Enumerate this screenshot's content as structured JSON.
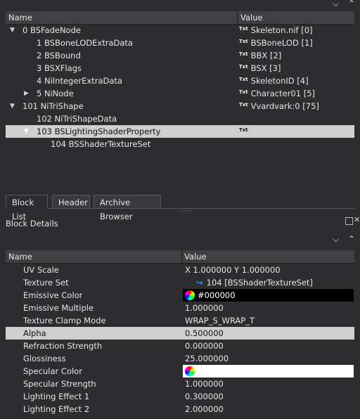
{
  "top_tree": {
    "columns": [
      "Name",
      "Value"
    ],
    "rows": [
      {
        "name": "0 BSFadeNode",
        "value": "Skeleton.nif [0]",
        "indent": 0,
        "expander": "down",
        "badge": "Txt"
      },
      {
        "name": "1 BSBoneLODExtraData",
        "value": "BSBoneLOD [1]",
        "indent": 1,
        "expander": "",
        "badge": "Txt"
      },
      {
        "name": "2 BSBound",
        "value": "BBX [2]",
        "indent": 1,
        "expander": "",
        "badge": "Txt"
      },
      {
        "name": "3 BSXFlags",
        "value": "BSX [3]",
        "indent": 1,
        "expander": "",
        "badge": "Txt"
      },
      {
        "name": "4 NiIntegerExtraData",
        "value": "SkeletonID [4]",
        "indent": 1,
        "expander": "",
        "badge": "Txt"
      },
      {
        "name": "5 NiNode",
        "value": "Character01 [5]",
        "indent": 1,
        "expander": "right",
        "badge": "Txt"
      },
      {
        "name": "101 NiTriShape",
        "value": "Vvardvark:0 [75]",
        "indent": 0,
        "expander": "down",
        "badge": "Txt"
      },
      {
        "name": "102 NiTriShapeData",
        "value": "",
        "indent": 1,
        "expander": "",
        "badge": ""
      },
      {
        "name": "103 BSLightingShaderProperty",
        "value": "",
        "indent": 1,
        "expander": "down",
        "badge": "Txt",
        "selected": true
      },
      {
        "name": "104 BSShaderTextureSet",
        "value": "",
        "indent": 2,
        "expander": "",
        "badge": ""
      }
    ]
  },
  "tabs": [
    "Block List",
    "Header",
    "Archive Browser"
  ],
  "block_details": {
    "title": "Block Details",
    "columns": [
      "Name",
      "Value"
    ],
    "rows": [
      {
        "name": "UV Scale",
        "value": "X 1.000000 Y 1.000000"
      },
      {
        "name": "Texture Set",
        "value": "104 [BSShaderTextureSet]",
        "kind": "link"
      },
      {
        "name": "Emissive Color",
        "value": "#000000",
        "kind": "color",
        "swatch": "#000000"
      },
      {
        "name": "Emissive Multiple",
        "value": "1.000000"
      },
      {
        "name": "Texture Clamp Mode",
        "value": "WRAP_S_WRAP_T"
      },
      {
        "name": "Alpha",
        "value": "0.500000",
        "selected": true
      },
      {
        "name": "Refraction Strength",
        "value": "0.000000"
      },
      {
        "name": "Glossiness",
        "value": "25.000000"
      },
      {
        "name": "Specular Color",
        "value": "",
        "kind": "color",
        "swatch": "#ffffff"
      },
      {
        "name": "Specular Strength",
        "value": "1.000000"
      },
      {
        "name": "Lighting Effect 1",
        "value": "0.300000"
      },
      {
        "name": "Lighting Effect 2",
        "value": "2.000000"
      }
    ]
  },
  "colors": {
    "selected_row": "#cfcfcf",
    "panel": "#2d2d30",
    "header": "#404043"
  }
}
